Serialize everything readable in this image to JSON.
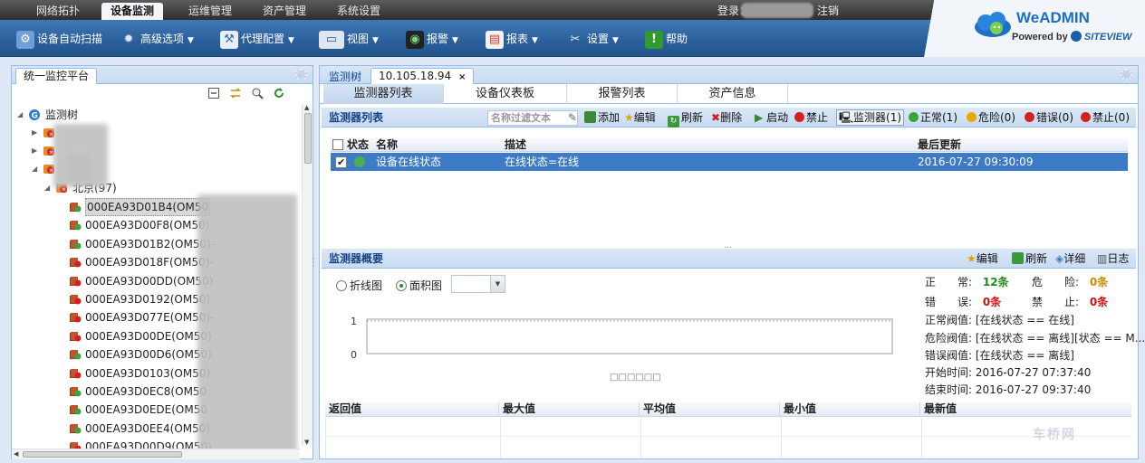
{
  "topnav": {
    "tabs": [
      {
        "label": "网络拓扑",
        "active": false
      },
      {
        "label": "设备监测",
        "active": true
      },
      {
        "label": "运维管理",
        "active": false
      },
      {
        "label": "资产管理",
        "active": false
      },
      {
        "label": "系统设置",
        "active": false
      }
    ],
    "login_label": "登录：",
    "logout_label": "注销"
  },
  "toolbar": {
    "items": [
      {
        "label": "设备自动扫描",
        "icon": "scan-icon",
        "has_menu": false
      },
      {
        "label": "高级选项",
        "icon": "gear-icon",
        "has_menu": true
      },
      {
        "label": "代理配置",
        "icon": "proxy-icon",
        "has_menu": true
      },
      {
        "label": "视图",
        "icon": "view-icon",
        "has_menu": true
      },
      {
        "label": "报警",
        "icon": "alarm-icon",
        "has_menu": true
      },
      {
        "label": "报表",
        "icon": "report-icon",
        "has_menu": true
      },
      {
        "label": "设置",
        "icon": "tools-icon",
        "has_menu": true
      },
      {
        "label": "帮助",
        "icon": "help-icon",
        "has_menu": false
      }
    ]
  },
  "logo": {
    "title": "WeADMIN",
    "powered_by": "Powered by",
    "brand": "SITEVIEW"
  },
  "left_panel": {
    "tab_label": "统一监控平台",
    "tree": {
      "root_label": "监测树",
      "group_label": "北京(97)",
      "devices": [
        {
          "label": "000EA93D01B4(OM50",
          "status": "ok",
          "selected": true
        },
        {
          "label": "000EA93D00F8(OM50)",
          "status": "ok"
        },
        {
          "label": "000EA93D01B2(OM50)-",
          "status": "ok"
        },
        {
          "label": "000EA93D018F(OM50)-",
          "status": "error"
        },
        {
          "label": "000EA93D00DD(OM50)",
          "status": "error"
        },
        {
          "label": "000EA93D0192(OM50)",
          "status": "error"
        },
        {
          "label": "000EA93D077E(OM50)-",
          "status": "error"
        },
        {
          "label": "000EA93D00DE(OM50)",
          "status": "error"
        },
        {
          "label": "000EA93D00D6(OM50)",
          "status": "ok"
        },
        {
          "label": "000EA93D0103(OM50)",
          "status": "error"
        },
        {
          "label": "000EA93D0EC8(OM50",
          "status": "ok"
        },
        {
          "label": "000EA93D0EDE(OM50",
          "status": "ok"
        },
        {
          "label": "000EA93D0EE4(OM50)",
          "status": "ok"
        },
        {
          "label": "000EA93D00D9(OM50)",
          "status": "error"
        }
      ]
    }
  },
  "right_panel": {
    "tab_prefix": "监测树",
    "tab_label": "10.105.18.94",
    "subtabs": [
      "监测器列表",
      "设备仪表板",
      "报警列表",
      "资产信息"
    ],
    "monitor_list": {
      "title": "监测器列表",
      "filter_placeholder": "名称过滤文本",
      "actions": {
        "add": "添加",
        "edit": "编辑",
        "refresh": "刷新",
        "delete": "删除",
        "start": "启动",
        "disable": "禁止",
        "monitor_count": "监测器(1)",
        "normal": "正常(1)",
        "danger": "危险(0)",
        "error": "错误(0)",
        "forbidden": "禁止(0)"
      },
      "columns": [
        "状态",
        "名称",
        "描述",
        "最后更新"
      ],
      "rows": [
        {
          "name": "设备在线状态",
          "desc": "在线状态=在线",
          "updated": "2016-07-27 09:30:09",
          "checked": true
        }
      ]
    },
    "summary": {
      "title": "监测器概要",
      "actions": {
        "edit": "编辑",
        "refresh": "刷新",
        "detail": "详细",
        "log": "日志"
      },
      "chart_modes": [
        {
          "label": "折线图",
          "selected": false
        },
        {
          "label": "面积图",
          "selected": true
        }
      ],
      "chart": {
        "y_top": "1",
        "y_bottom": "0",
        "legend_text": "□□□□□□"
      },
      "stats": {
        "normal_label": "正　　常:",
        "normal_value": "12条",
        "danger_label": "危　　险:",
        "danger_value": "0条",
        "error_label": "错　　误:",
        "error_value": "0条",
        "forbid_label": "禁　　止:",
        "forbid_value": "0条"
      },
      "thresholds": [
        {
          "k": "正常阀值:",
          "v": "[在线状态 == 在线]"
        },
        {
          "k": "危险阀值:",
          "v": "[在线状态 == 离线][状态 == M..."
        },
        {
          "k": "错误阀值:",
          "v": "[在线状态 == 离线]"
        },
        {
          "k": "开始时间:",
          "v": "2016-07-27 07:37:40"
        },
        {
          "k": "结束时间:",
          "v": "2016-07-27 09:37:40"
        }
      ],
      "table_columns": [
        "返回值",
        "最大值",
        "平均值",
        "最小值",
        "最新值"
      ]
    }
  },
  "watermark": "车桥网",
  "colors": {
    "accent": "#2a5f9c",
    "selected_row": "#3d7bc7",
    "ok": "#2e9a2e",
    "error": "#d42020"
  }
}
